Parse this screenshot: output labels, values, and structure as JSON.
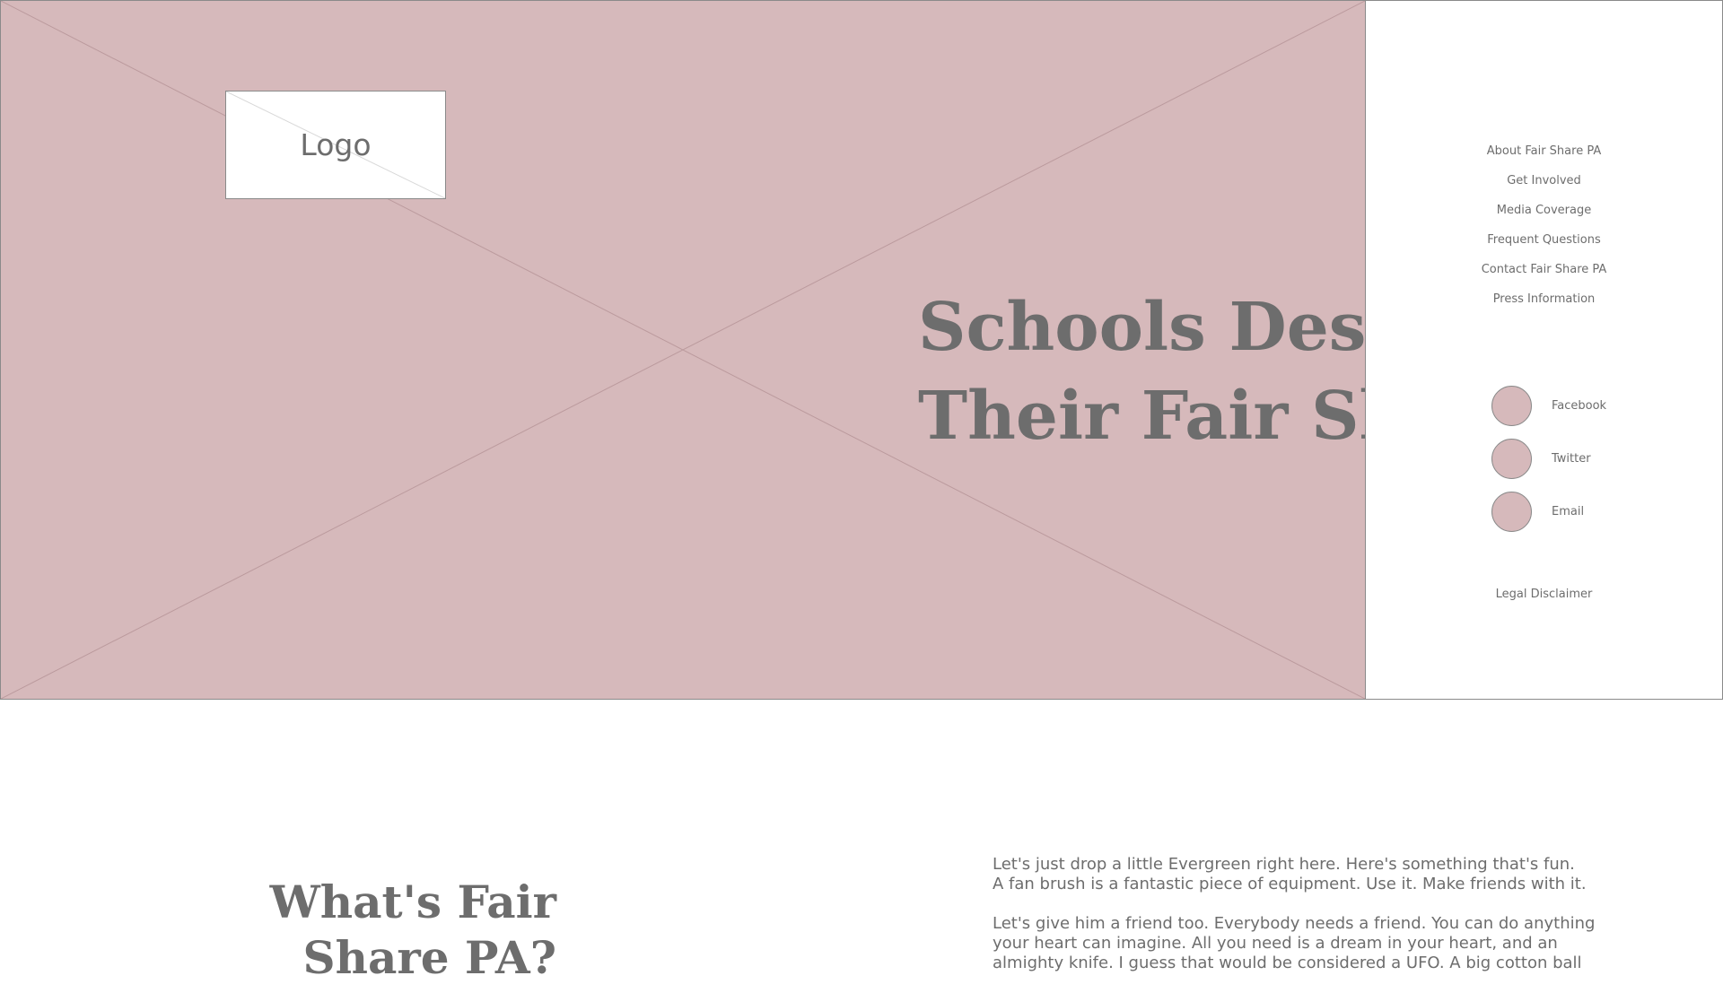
{
  "hero": {
    "logo_label": "Logo",
    "title_line1": "Schools Deserve",
    "title_line2": "Their Fair Share"
  },
  "nav": {
    "items": [
      {
        "label": "About Fair Share PA"
      },
      {
        "label": "Get Involved"
      },
      {
        "label": "Media Coverage"
      },
      {
        "label": "Frequent Questions"
      },
      {
        "label": "Contact Fair Share PA"
      },
      {
        "label": "Press Information"
      }
    ],
    "social": [
      {
        "label": "Facebook",
        "icon": "facebook-icon"
      },
      {
        "label": "Twitter",
        "icon": "twitter-icon"
      },
      {
        "label": "Email",
        "icon": "email-icon"
      }
    ],
    "legal": "Legal Disclaimer"
  },
  "intro": {
    "heading": "What's Fair Share PA?",
    "paragraph1": "Let's just drop a little Evergreen right here. Here's something that's fun.\nA fan brush is a fantastic piece of equipment. Use it. Make friends with it.",
    "paragraph2": "Let's give him a friend too. Everybody needs a friend. You can do anything\nyour heart can imagine. All you need is a dream in your heart, and an\nalmighty knife. I guess that would be considered a UFO. A big cotton ball"
  },
  "colors": {
    "hero_background": "#d6b9bb",
    "text": "#6d6d6d",
    "border": "#8a8a8a",
    "panel": "#ffffff"
  }
}
